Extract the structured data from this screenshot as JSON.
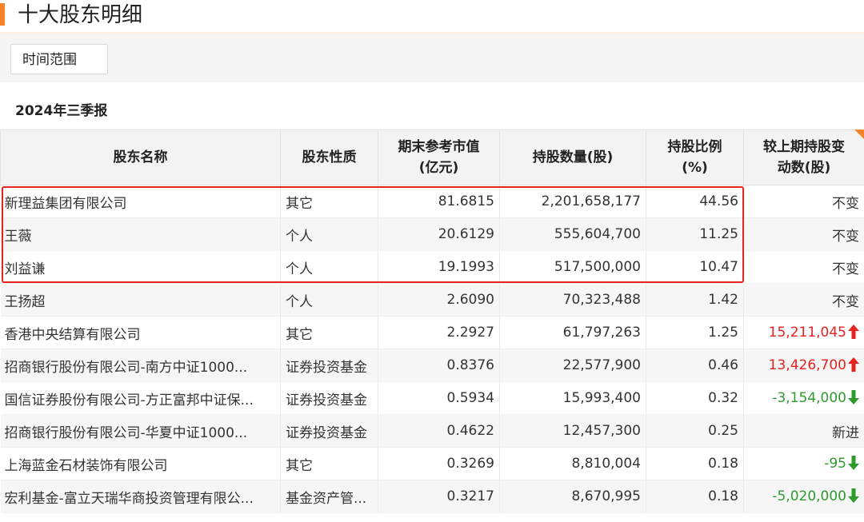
{
  "header": {
    "title": "十大股东明细"
  },
  "controls": {
    "time_range_label": "时间范围"
  },
  "period": {
    "label": "2024年三季报"
  },
  "table": {
    "columns": [
      "股东名称",
      "股东性质",
      "期末参考市值\n(亿元)",
      "持股数量(股)",
      "持股比例\n(%)",
      "较上期持股变\n动数(股)"
    ],
    "rows": [
      {
        "name": "新理益集团有限公司",
        "type": "其它",
        "value": "81.6815",
        "shares": "2,201,658,177",
        "ratio": "44.56",
        "change": "不变",
        "trend": "flat"
      },
      {
        "name": "王薇",
        "type": "个人",
        "value": "20.6129",
        "shares": "555,604,700",
        "ratio": "11.25",
        "change": "不变",
        "trend": "flat"
      },
      {
        "name": "刘益谦",
        "type": "个人",
        "value": "19.1993",
        "shares": "517,500,000",
        "ratio": "10.47",
        "change": "不变",
        "trend": "flat"
      },
      {
        "name": "王扬超",
        "type": "个人",
        "value": "2.6090",
        "shares": "70,323,488",
        "ratio": "1.42",
        "change": "不变",
        "trend": "flat"
      },
      {
        "name": "香港中央结算有限公司",
        "type": "其它",
        "value": "2.2927",
        "shares": "61,797,263",
        "ratio": "1.25",
        "change": "15,211,045",
        "trend": "up"
      },
      {
        "name": "招商银行股份有限公司-南方中证1000...",
        "type": "证券投资基金",
        "value": "0.8376",
        "shares": "22,577,900",
        "ratio": "0.46",
        "change": "13,426,700",
        "trend": "up"
      },
      {
        "name": "国信证券股份有限公司-方正富邦中证保...",
        "type": "证券投资基金",
        "value": "0.5934",
        "shares": "15,993,400",
        "ratio": "0.32",
        "change": "-3,154,000",
        "trend": "down"
      },
      {
        "name": "招商银行股份有限公司-华夏中证1000...",
        "type": "证券投资基金",
        "value": "0.4622",
        "shares": "12,457,300",
        "ratio": "0.25",
        "change": "新进",
        "trend": "flat"
      },
      {
        "name": "上海蓝金石材装饰有限公司",
        "type": "其它",
        "value": "0.3269",
        "shares": "8,810,004",
        "ratio": "0.18",
        "change": "-95",
        "trend": "down"
      },
      {
        "name": "宏利基金-富立天瑞华商投资管理有限公...",
        "type": "基金资产管...",
        "value": "0.3217",
        "shares": "8,670,995",
        "ratio": "0.18",
        "change": "-5,020,000",
        "trend": "down"
      }
    ]
  },
  "colors": {
    "accent": "#f3842b",
    "up": "#e8221e",
    "down": "#2e9b2e",
    "highlight": "#e8221e"
  },
  "icons": {
    "up": "arrow-up-icon",
    "down": "arrow-down-icon"
  }
}
